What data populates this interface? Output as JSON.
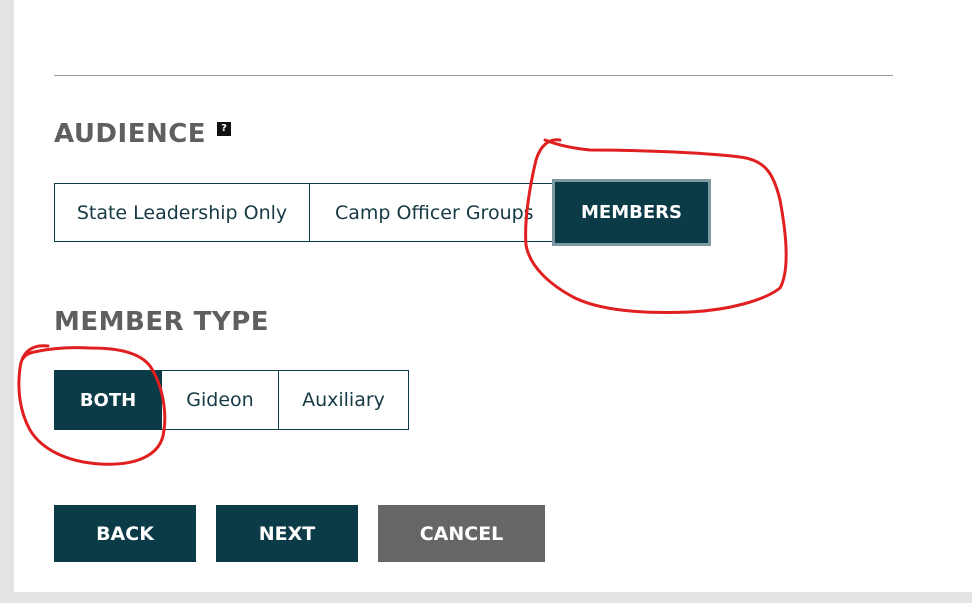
{
  "audience": {
    "title": "AUDIENCE",
    "help_icon": "?",
    "options": [
      {
        "label": "State Leadership Only",
        "selected": false
      },
      {
        "label": "Camp Officer Groups",
        "selected": false
      },
      {
        "label": "MEMBERS",
        "selected": true
      }
    ]
  },
  "member_type": {
    "title": "MEMBER TYPE",
    "options": [
      {
        "label": "BOTH",
        "selected": true
      },
      {
        "label": "Gideon",
        "selected": false
      },
      {
        "label": "Auxiliary",
        "selected": false
      }
    ]
  },
  "actions": {
    "back_label": "BACK",
    "next_label": "NEXT",
    "cancel_label": "CANCEL"
  },
  "colors": {
    "primary": "#0b3b47",
    "cancel": "#666666",
    "annotation": "#e02020"
  }
}
